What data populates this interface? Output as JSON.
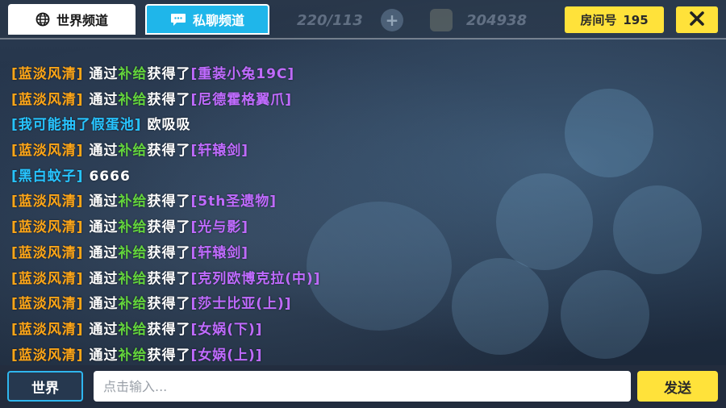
{
  "tabs": {
    "world_label": "世界频道",
    "private_label": "私聊频道"
  },
  "resources": {
    "energy": "220/113",
    "coins": "204938"
  },
  "room": {
    "label": "房间号",
    "number": "195"
  },
  "chat_messages": [
    {
      "sender": "[蓝淡风清]",
      "via": "通过",
      "source": "补给",
      "action": "获得了",
      "item": "[重装小兔19C]",
      "sender_color": "orange"
    },
    {
      "sender": "[蓝淡风清]",
      "via": "通过",
      "source": "补给",
      "action": "获得了",
      "item": "[尼德霍格翼爪]",
      "sender_color": "orange"
    },
    {
      "sender": "[我可能抽了假蛋池]",
      "text": "欧吸吸",
      "sender_color": "blue"
    },
    {
      "sender": "[蓝淡风清]",
      "via": "通过",
      "source": "补给",
      "action": "获得了",
      "item": "[轩辕剑]",
      "sender_color": "orange"
    },
    {
      "sender": "[黑白蚊子]",
      "text": "6666",
      "sender_color": "blue"
    },
    {
      "sender": "[蓝淡风清]",
      "via": "通过",
      "source": "补给",
      "action": "获得了",
      "item": "[5th圣遗物]",
      "sender_color": "orange"
    },
    {
      "sender": "[蓝淡风清]",
      "via": "通过",
      "source": "补给",
      "action": "获得了",
      "item": "[光与影]",
      "sender_color": "orange"
    },
    {
      "sender": "[蓝淡风清]",
      "via": "通过",
      "source": "补给",
      "action": "获得了",
      "item": "[轩辕剑]",
      "sender_color": "orange"
    },
    {
      "sender": "[蓝淡风清]",
      "via": "通过",
      "source": "补给",
      "action": "获得了",
      "item": "[克列欧博克拉(中)]",
      "sender_color": "orange"
    },
    {
      "sender": "[蓝淡风清]",
      "via": "通过",
      "source": "补给",
      "action": "获得了",
      "item": "[莎士比亚(上)]",
      "sender_color": "orange"
    },
    {
      "sender": "[蓝淡风清]",
      "via": "通过",
      "source": "补给",
      "action": "获得了",
      "item": "[女娲(下)]",
      "sender_color": "orange"
    },
    {
      "sender": "[蓝淡风清]",
      "via": "通过",
      "source": "补给",
      "action": "获得了",
      "item": "[女娲(上)]",
      "sender_color": "orange"
    }
  ],
  "bottom": {
    "channel_button": "世界",
    "input_placeholder": "点击输入...",
    "send_button": "发送"
  },
  "colors": {
    "accent_yellow": "#ffe23a",
    "tab_blue": "#1fb6ea",
    "sender_orange": "#ffa617",
    "sender_blue": "#27c4ff",
    "source_green": "#63d43c",
    "item_purple": "#c06bff"
  }
}
